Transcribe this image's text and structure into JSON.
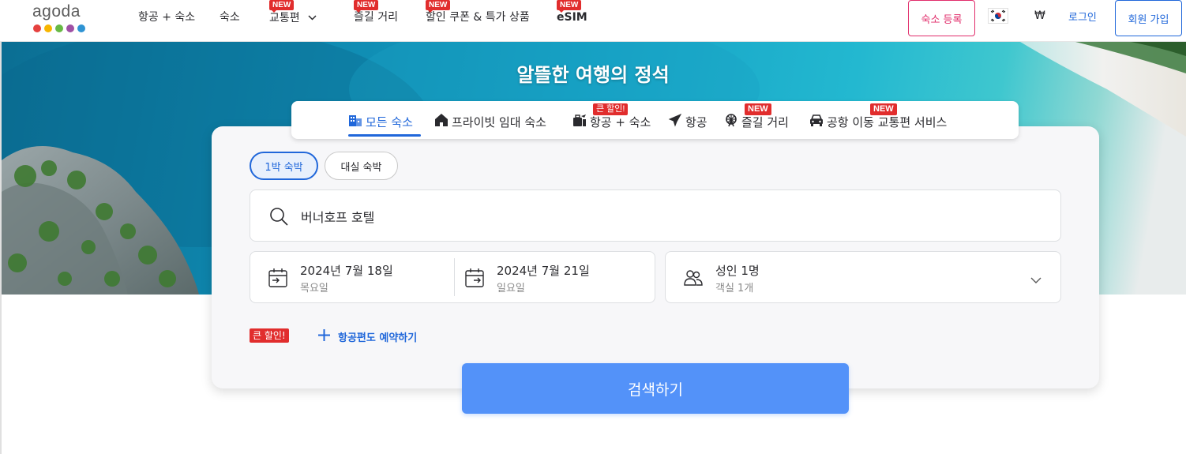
{
  "brand": {
    "logo_text": "agoda",
    "dot_colors": [
      "#e5413f",
      "#f7b500",
      "#67b944",
      "#9f50a4",
      "#2e93d3"
    ]
  },
  "nav": {
    "items": [
      {
        "label": "항공 + 숙소",
        "badge": ""
      },
      {
        "label": "숙소",
        "badge": ""
      },
      {
        "label": "교통편",
        "badge": "NEW"
      },
      {
        "label": "즐길 거리",
        "badge": "NEW"
      },
      {
        "label": "할인 쿠폰 & 특가 상품",
        "badge": "NEW"
      },
      {
        "label": "eSIM",
        "badge": "NEW"
      }
    ],
    "register_label": "숙소 등록",
    "currency": "₩",
    "login_label": "로그인",
    "signup_label": "회원 가입"
  },
  "hero": {
    "title": "알뜰한 여행의 정석"
  },
  "tabs": [
    {
      "label": "모든 숙소",
      "badge": "",
      "icon": "building-icon"
    },
    {
      "label": "프라이빗 임대 숙소",
      "badge": "",
      "icon": "house-icon"
    },
    {
      "label": "항공 + 숙소",
      "badge": "큰 할인!",
      "icon": "suitcase-plane-icon"
    },
    {
      "label": "항공",
      "badge": "",
      "icon": "airplane-icon"
    },
    {
      "label": "즐길 거리",
      "badge": "NEW",
      "icon": "ferris-wheel-icon"
    },
    {
      "label": "공항 이동 교통편 서비스",
      "badge": "NEW",
      "icon": "car-icon"
    }
  ],
  "search": {
    "stay_types": [
      "1박 숙박",
      "대실 숙박"
    ],
    "query": "버너호프 호텔",
    "checkin": {
      "date": "2024년 7월 18일",
      "weekday": "목요일"
    },
    "checkout": {
      "date": "2024년 7월 21일",
      "weekday": "일요일"
    },
    "guests": {
      "main": "성인 1명",
      "sub": "객실 1개"
    },
    "sale_badge": "큰 할인!",
    "add_flight_label": "항공편도 예약하기",
    "submit_label": "검색하기"
  },
  "colors": {
    "primary": "#2067da",
    "accent_pink": "#e12d6b",
    "badge_red": "#e12d2d",
    "search_button": "#5392f9"
  }
}
